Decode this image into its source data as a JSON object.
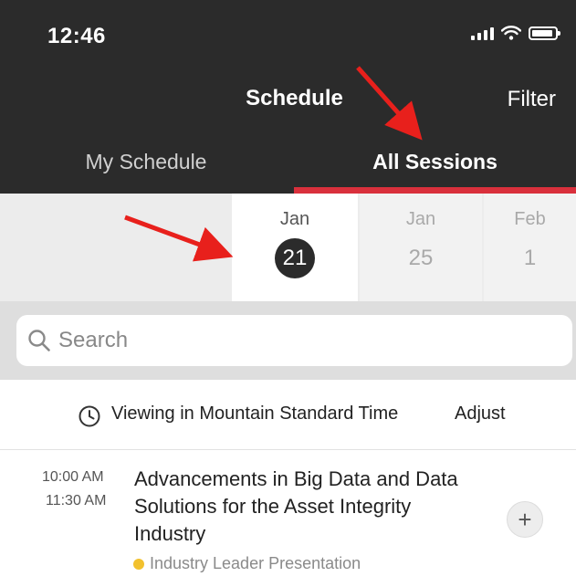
{
  "status_bar": {
    "time": "12:46"
  },
  "header": {
    "title": "Schedule",
    "filter_label": "Filter"
  },
  "tabs": [
    {
      "label": "My Schedule",
      "active": false
    },
    {
      "label": "All Sessions",
      "active": true
    }
  ],
  "dates": [
    {
      "month": "Jan",
      "day": "21",
      "selected": true
    },
    {
      "month": "Jan",
      "day": "25",
      "selected": false
    },
    {
      "month": "Feb",
      "day": "1",
      "selected": false
    }
  ],
  "search": {
    "placeholder": "Search",
    "value": ""
  },
  "timezone": {
    "text": "Viewing in Mountain Standard Time",
    "adjust_label": "Adjust"
  },
  "sessions": [
    {
      "start": "10:00 AM",
      "end": "11:30 AM",
      "title": "Advancements in Big Data and Data Solutions for the Asset Integrity Industry",
      "type": "Industry Leader Presentation",
      "type_color": "#f2c12e"
    }
  ],
  "colors": {
    "header_bg": "#2b2b2b",
    "accent": "#d9303c",
    "annotation_arrow": "#e8201c"
  },
  "icons": [
    "signal-icon",
    "wifi-icon",
    "battery-icon",
    "search-icon",
    "clock-icon",
    "plus-icon",
    "annotation-arrow"
  ]
}
